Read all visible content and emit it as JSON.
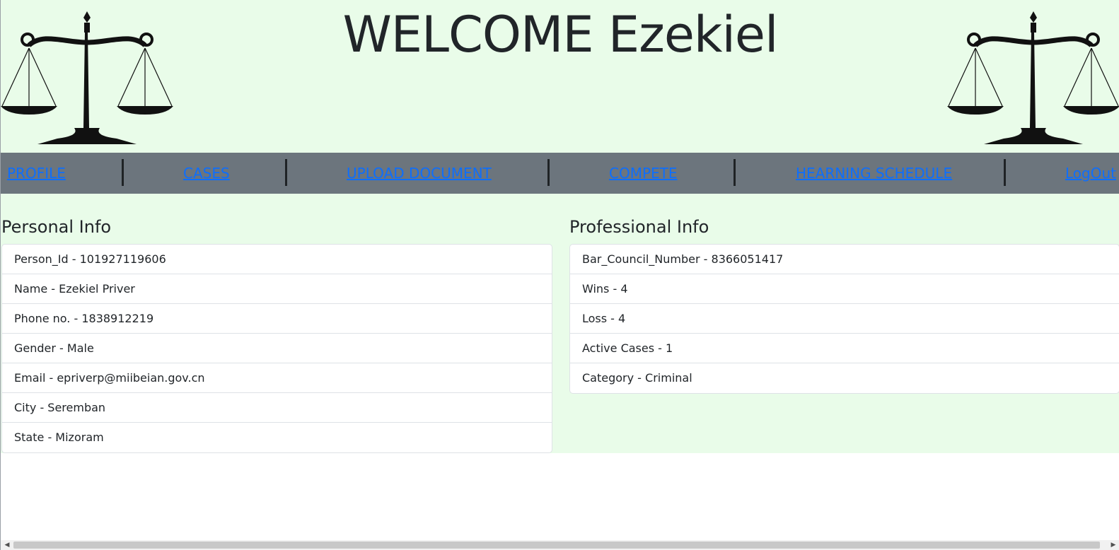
{
  "header": {
    "title": "WELCOME Ezekiel",
    "icon_left": "scales-of-justice-icon",
    "icon_right": "scales-of-justice-icon"
  },
  "nav": {
    "items": [
      {
        "label": "PROFILE"
      },
      {
        "label": "CASES"
      },
      {
        "label": "UPLOAD DOCUMENT"
      },
      {
        "label": "COMPETE"
      },
      {
        "label": "HEARNING SCHEDULE"
      },
      {
        "label": "LogOut"
      }
    ]
  },
  "personal": {
    "heading": "Personal Info",
    "items": [
      "Person_Id - 101927119606",
      "Name - Ezekiel Priver",
      "Phone no. - 1838912219",
      "Gender - Male",
      "Email - epriverp@miibeian.gov.cn",
      "City - Seremban",
      "State - Mizoram"
    ]
  },
  "professional": {
    "heading": "Professional Info",
    "items": [
      "Bar_Council_Number - 8366051417",
      "Wins - 4",
      "Loss - 4",
      "Active Cases - 1",
      "Category - Criminal"
    ]
  },
  "colors": {
    "background_green": "#e9fce9",
    "nav_gray": "#6c757d",
    "link_blue": "#0d6efd",
    "text_dark": "#212529"
  }
}
